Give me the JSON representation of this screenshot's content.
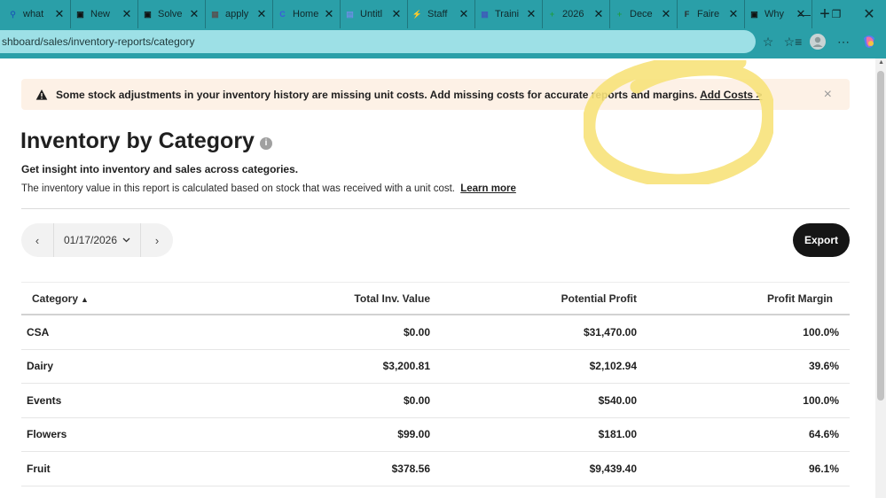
{
  "browser": {
    "tabs": [
      {
        "label": "what",
        "icon": "search-icon",
        "color": "#1a5fb4"
      },
      {
        "label": "New",
        "icon": "square-app-icon",
        "color": "#111111"
      },
      {
        "label": "Solve",
        "icon": "square-app-icon",
        "color": "#111111"
      },
      {
        "label": "apply",
        "icon": "document-app-icon",
        "color": "#555555"
      },
      {
        "label": "Home",
        "icon": "c-logo-icon",
        "color": "#3b5bdb"
      },
      {
        "label": "Untitl",
        "icon": "document-icon",
        "color": "#6a8fe0"
      },
      {
        "label": "Staff",
        "icon": "bolt-icon",
        "color": "#c9a40f"
      },
      {
        "label": "Traini",
        "icon": "sheet-icon",
        "color": "#3d5fb8"
      },
      {
        "label": "2026",
        "icon": "plus-green-icon",
        "color": "#1e9e4a"
      },
      {
        "label": "Dece",
        "icon": "plus-green-icon",
        "color": "#1e9e4a"
      },
      {
        "label": "Faire",
        "icon": "f-logo-icon",
        "color": "#2b2b2b"
      },
      {
        "label": "Why",
        "icon": "square-app-icon",
        "color": "#111111"
      }
    ],
    "new_tab": "+",
    "url": "shboard/sales/inventory-reports/category"
  },
  "banner": {
    "message": "Some stock adjustments in your inventory history are missing unit costs. Add missing costs for accurate reports and margins.",
    "link": "Add Costs >",
    "close": "×"
  },
  "header": {
    "title": "Inventory by Category",
    "info": "i",
    "subtitle": "Get insight into inventory and sales across categories.",
    "description": "The inventory value in this report is calculated based on stock that was received with a unit cost.",
    "learn_more": "Learn more"
  },
  "controls": {
    "prev": "‹",
    "date": "01/17/2026",
    "next": "›",
    "export": "Export"
  },
  "table": {
    "headers": {
      "category": "Category",
      "total": "Total Inv. Value",
      "profit": "Potential Profit",
      "margin": "Profit Margin"
    },
    "rows": [
      {
        "category": "CSA",
        "total": "$0.00",
        "profit": "$31,470.00",
        "margin": "100.0%"
      },
      {
        "category": "Dairy",
        "total": "$3,200.81",
        "profit": "$2,102.94",
        "margin": "39.6%"
      },
      {
        "category": "Events",
        "total": "$0.00",
        "profit": "$540.00",
        "margin": "100.0%"
      },
      {
        "category": "Flowers",
        "total": "$99.00",
        "profit": "$181.00",
        "margin": "64.6%"
      },
      {
        "category": "Fruit",
        "total": "$378.56",
        "profit": "$9,439.40",
        "margin": "96.1%"
      }
    ]
  },
  "colors": {
    "browser_chrome": "#2a9fa8",
    "banner_bg": "#fdf1e6",
    "export_bg": "#151515",
    "highlight": "#f7e27a"
  }
}
